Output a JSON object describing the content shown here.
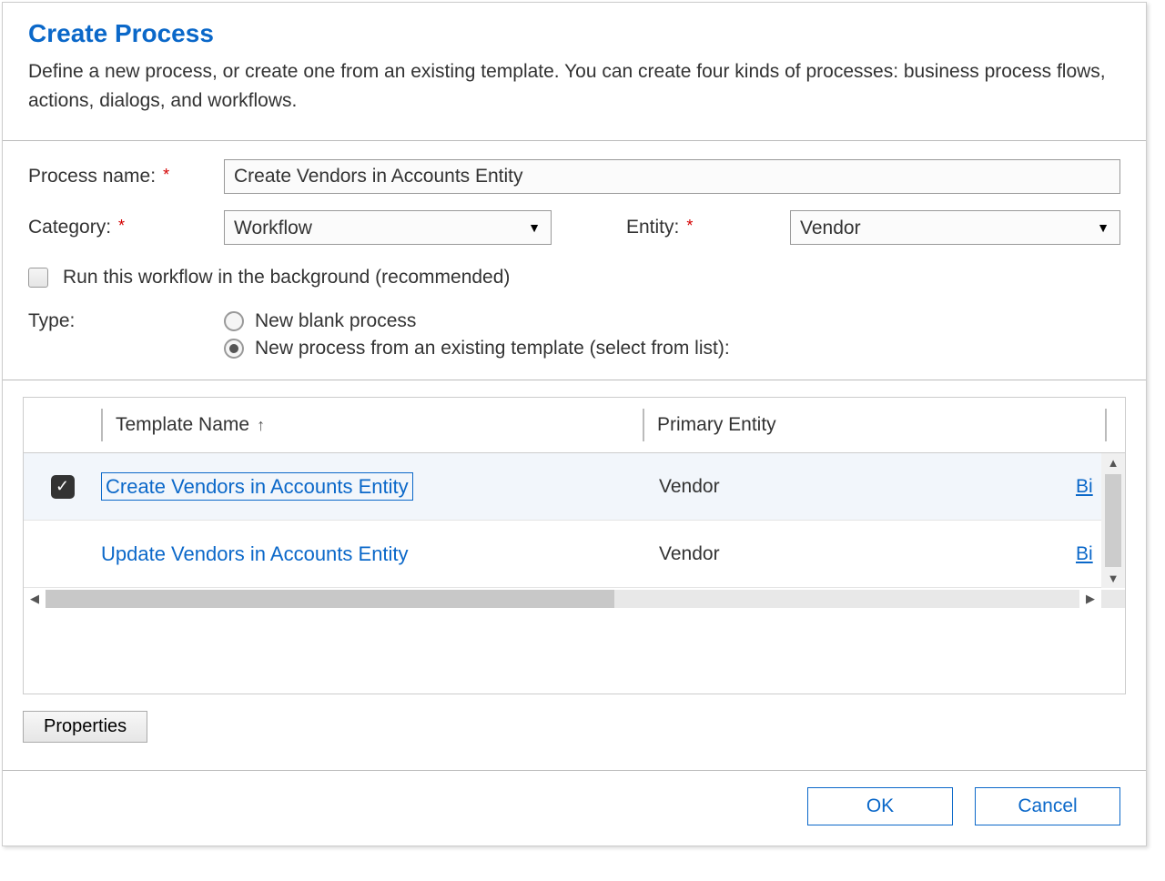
{
  "header": {
    "title": "Create Process",
    "subtitle": "Define a new process, or create one from an existing template. You can create four kinds of processes: business process flows, actions, dialogs, and workflows."
  },
  "labels": {
    "process_name": "Process name:",
    "category": "Category:",
    "entity": "Entity:",
    "type": "Type:",
    "run_background": "Run this workflow in the background (recommended)"
  },
  "values": {
    "process_name": "Create Vendors in Accounts Entity",
    "category": "Workflow",
    "entity": "Vendor"
  },
  "type_options": {
    "blank": "New blank process",
    "template": "New process from an existing template (select from list):",
    "selected": "template"
  },
  "table": {
    "columns": {
      "template_name": "Template Name",
      "primary_entity": "Primary Entity"
    },
    "rows": [
      {
        "checked": true,
        "focused": true,
        "name": "Create Vendors in Accounts Entity",
        "entity": "Vendor",
        "extra": "Bi"
      },
      {
        "checked": false,
        "focused": false,
        "name": "Update Vendors in Accounts Entity",
        "entity": "Vendor",
        "extra": "Bi"
      }
    ]
  },
  "buttons": {
    "properties": "Properties",
    "ok": "OK",
    "cancel": "Cancel"
  },
  "icons": {
    "sort_asc": "↑",
    "dropdown": "▼",
    "check": "✓",
    "scroll_up": "▲",
    "scroll_down": "▼",
    "scroll_left": "◀",
    "scroll_right": "▶"
  }
}
